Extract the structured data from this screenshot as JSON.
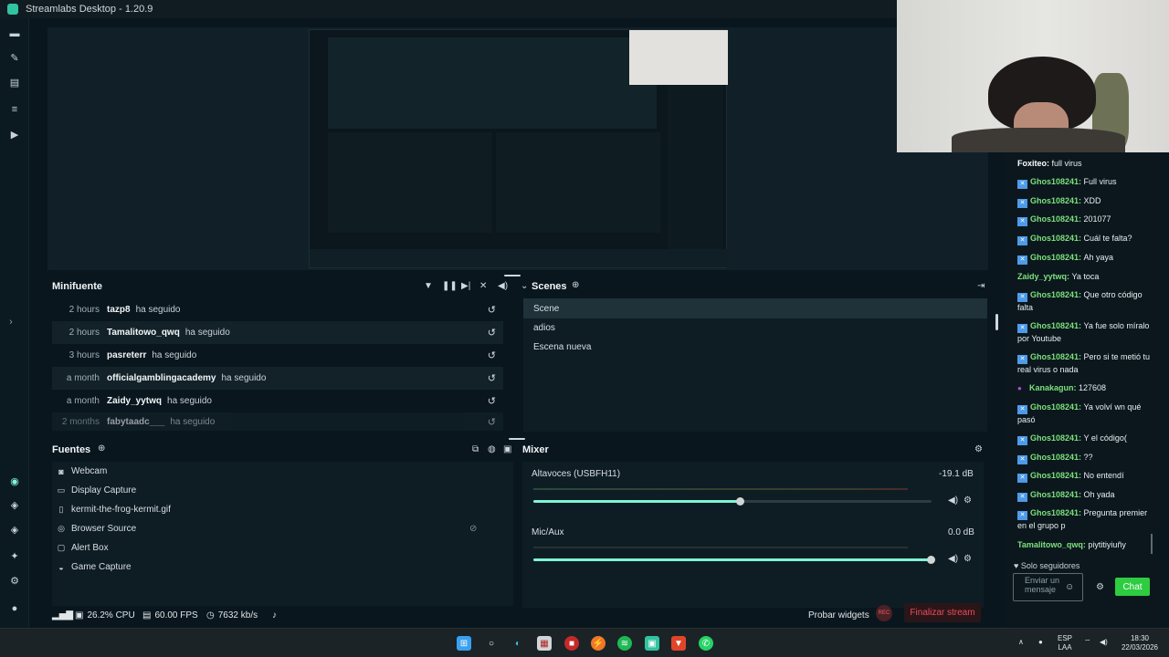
{
  "app": {
    "title": "Streamlabs Desktop - 1.20.9"
  },
  "minifuente": {
    "title": "Minifuente",
    "rows": [
      {
        "time": "2 hours",
        "user": "tazp8",
        "action": "ha seguido"
      },
      {
        "time": "2 hours",
        "user": "Tamalitowo_qwq",
        "action": "ha seguido"
      },
      {
        "time": "3 hours",
        "user": "pasreterr",
        "action": "ha seguido"
      },
      {
        "time": "a month",
        "user": "officialgamblingacademy",
        "action": "ha seguido"
      },
      {
        "time": "a month",
        "user": "Zaidy_yytwq",
        "action": "ha seguido"
      },
      {
        "time": "2 months",
        "user": "fabytaadc___",
        "action": "ha seguido"
      }
    ]
  },
  "scenes": {
    "title": "Scenes",
    "items": [
      "Scene",
      "adios",
      "Escena nueva"
    ],
    "selected": "Scene"
  },
  "fuentes": {
    "title": "Fuentes",
    "items": [
      {
        "label": "Webcam",
        "icon": "webcam-icon"
      },
      {
        "label": "Display Capture",
        "icon": "monitor-icon"
      },
      {
        "label": "kermit-the-frog-kermit.gif",
        "icon": "file-icon"
      },
      {
        "label": "Browser Source",
        "icon": "globe-icon"
      },
      {
        "label": "Alert Box",
        "icon": "alert-box-icon"
      },
      {
        "label": "Game Capture",
        "icon": "gamepad-icon"
      }
    ]
  },
  "mixer": {
    "title": "Mixer",
    "channels": [
      {
        "name": "Altavoces (USBFH11)",
        "db": "-19.1 dB",
        "level": 0.52
      },
      {
        "name": "Mic/Aux",
        "db": "0.0 dB",
        "level": 1.0
      }
    ]
  },
  "status": {
    "cpu": "26.2% CPU",
    "fps": "60.00 FPS",
    "bitrate": "7632 kb/s",
    "test_widgets": "Probar widgets",
    "rec": "REC",
    "end_stream": "Finalizar stream"
  },
  "chat": {
    "messages": [
      {
        "user": "Foxiteo",
        "text": "full virus",
        "color": "#ffffff",
        "badge": false
      },
      {
        "user": "Ghos108241",
        "text": "Full virus",
        "color": "#7de07d",
        "badge": true
      },
      {
        "user": "Ghos108241",
        "text": "XDD",
        "color": "#7de07d",
        "badge": true
      },
      {
        "user": "Ghos108241",
        "text": "201077",
        "color": "#7de07d",
        "badge": true
      },
      {
        "user": "Ghos108241",
        "text": "Cuál te falta?",
        "color": "#7de07d",
        "badge": true
      },
      {
        "user": "Ghos108241",
        "text": "Ah yaya",
        "color": "#7de07d",
        "badge": true
      },
      {
        "user": "Zaidy_yytwq",
        "text": "Ya toca",
        "color": "#7de07d",
        "badge": false
      },
      {
        "user": "Ghos108241",
        "text": "Que otro código falta",
        "color": "#7de07d",
        "badge": true
      },
      {
        "user": "Ghos108241",
        "text": "Ya fue solo míralo por Youtube",
        "color": "#7de07d",
        "badge": true
      },
      {
        "user": "Ghos108241",
        "text": "Pero si te metió tu real virus o nada",
        "color": "#7de07d",
        "badge": true
      },
      {
        "user": "Kanakagun",
        "text": "127608",
        "color": "#7de07d",
        "badge": false,
        "mic": true
      },
      {
        "user": "Ghos108241",
        "text": "Ya volví wn qué pasó",
        "color": "#7de07d",
        "badge": true
      },
      {
        "user": "Ghos108241",
        "text": "Y el código(",
        "color": "#7de07d",
        "badge": true
      },
      {
        "user": "Ghos108241",
        "text": "??",
        "color": "#7de07d",
        "badge": true
      },
      {
        "user": "Ghos108241",
        "text": "No entendí",
        "color": "#7de07d",
        "badge": true
      },
      {
        "user": "Ghos108241",
        "text": "Oh yada",
        "color": "#7de07d",
        "badge": true
      },
      {
        "user": "Ghos108241",
        "text": "Pregunta premier en el grupo p",
        "color": "#7de07d",
        "badge": true
      },
      {
        "user": "Tamalitowo_qwq",
        "text": "piytitiyiuñy",
        "color": "#7de07d",
        "badge": false
      }
    ],
    "followers_only": "Solo seguidores",
    "input_placeholder": "Enviar un mensaje",
    "send_label": "Chat"
  },
  "taskbar": {
    "lang1": "ESP",
    "lang2": "LAA",
    "time": "18:30",
    "date": "22/03/2026"
  },
  "colors": {
    "accent": "#80f5d2",
    "danger": "#f04a5c",
    "chat_green": "#2ecc40"
  }
}
